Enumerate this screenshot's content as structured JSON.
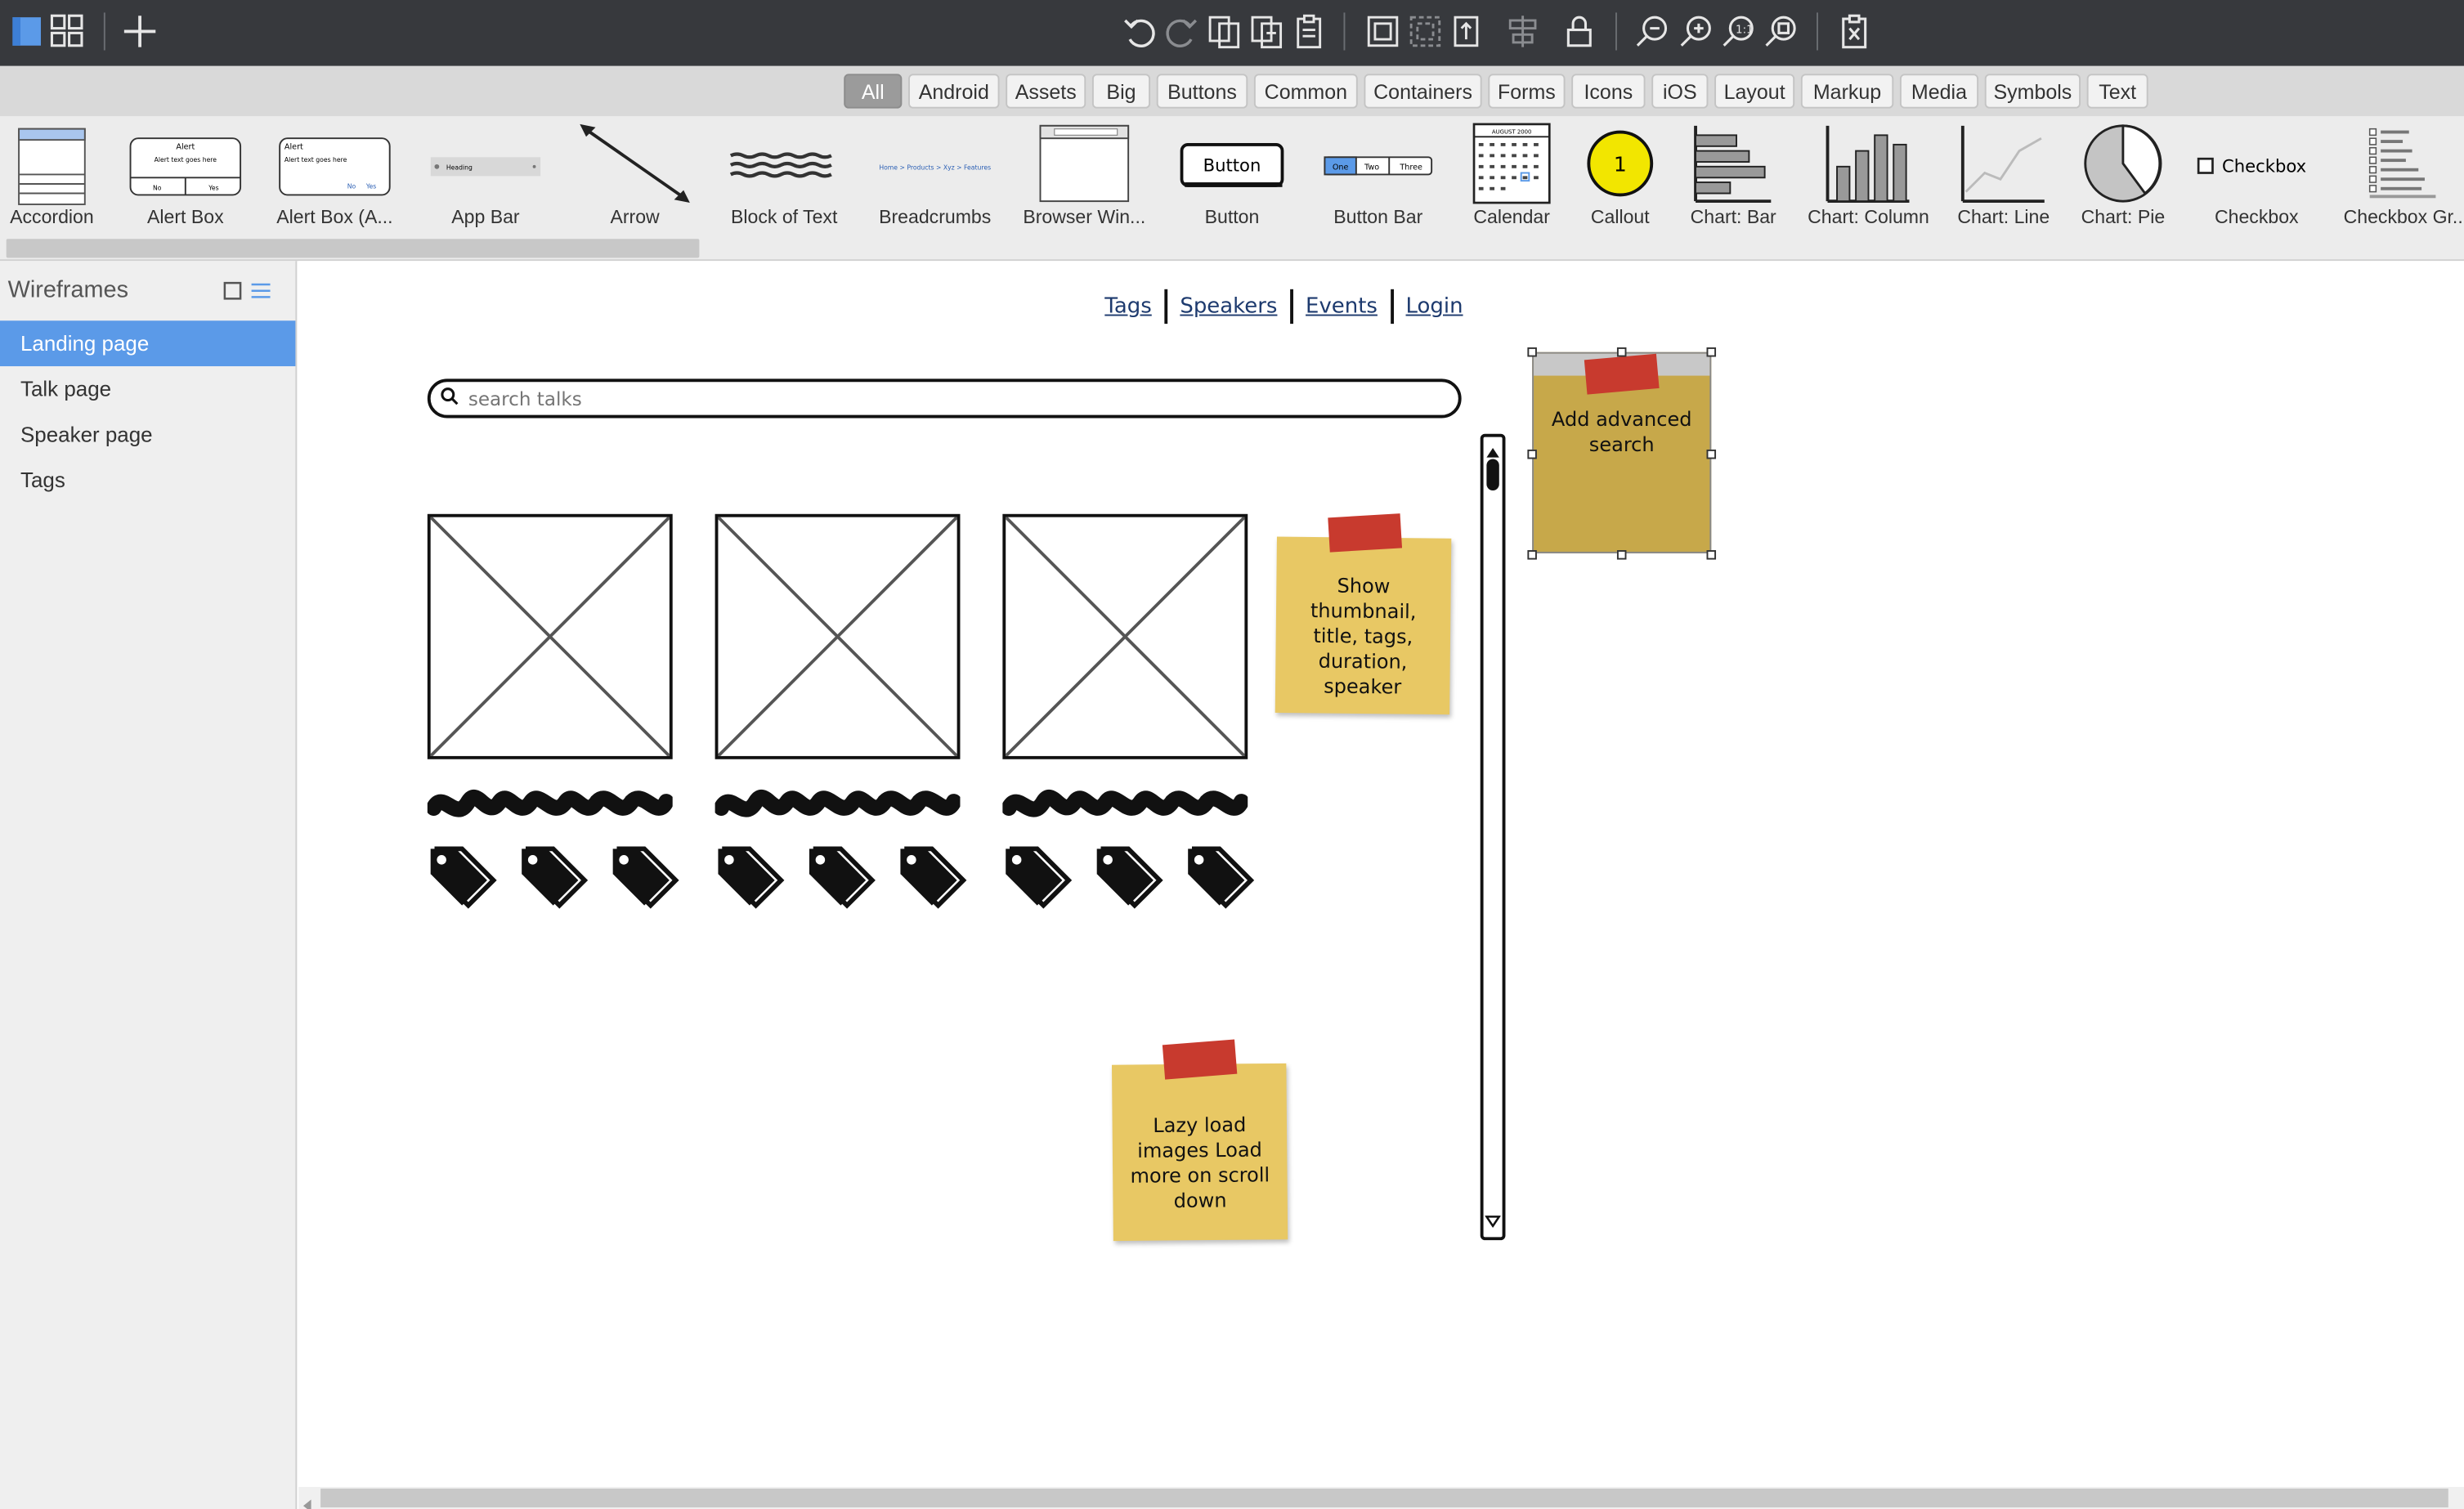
{
  "toolbar": {
    "icons": [
      "single-view-icon",
      "grid-view-icon",
      "add-icon",
      "undo-icon",
      "redo-icon",
      "copy-icon",
      "duplicate-icon",
      "paste-icon",
      "group-icon",
      "ungroup-icon",
      "bring-front-icon",
      "align-icon",
      "lock-icon",
      "zoom-out-icon",
      "zoom-in-icon",
      "actual-size-icon",
      "fit-icon",
      "delete-icon"
    ]
  },
  "filters": {
    "active": "All",
    "tabs": [
      "All",
      "Android",
      "Assets",
      "Big",
      "Buttons",
      "Common",
      "Containers",
      "Forms",
      "Icons",
      "iOS",
      "Layout",
      "Markup",
      "Media",
      "Symbols",
      "Text"
    ]
  },
  "library": {
    "items": [
      {
        "label": "Accordion"
      },
      {
        "label": "Alert Box"
      },
      {
        "label": "Alert Box (A..."
      },
      {
        "label": "App Bar"
      },
      {
        "label": "Arrow"
      },
      {
        "label": "Block of Text"
      },
      {
        "label": "Breadcrumbs"
      },
      {
        "label": "Browser Win..."
      },
      {
        "label": "Button"
      },
      {
        "label": "Button Bar"
      },
      {
        "label": "Calendar"
      },
      {
        "label": "Callout"
      },
      {
        "label": "Chart: Bar"
      },
      {
        "label": "Chart: Column"
      },
      {
        "label": "Chart: Line"
      },
      {
        "label": "Chart: Pie"
      },
      {
        "label": "Checkbox"
      },
      {
        "label": "Checkbox Gr..."
      }
    ],
    "thumb_text": {
      "alert_title": "Alert",
      "alert_body": "Alert text goes here",
      "alert_no": "No",
      "alert_yes": "Yes",
      "appbar_heading": "Heading",
      "button": "Button",
      "buttonbar": [
        "One",
        "Two",
        "Three"
      ],
      "callout": "1",
      "checkbox": "Checkbox",
      "calendar_month": "AUGUST 2000",
      "breadcrumbs": "Home > Products > Xyz > Features"
    }
  },
  "sidebar": {
    "title": "Wireframes",
    "items": [
      {
        "label": "Landing page",
        "active": true
      },
      {
        "label": "Talk page",
        "active": false
      },
      {
        "label": "Speaker page",
        "active": false
      },
      {
        "label": "Tags",
        "active": false
      }
    ]
  },
  "canvas": {
    "nav": [
      "Tags",
      "Speakers",
      "Events",
      "Login"
    ],
    "search": {
      "placeholder": "search talks"
    },
    "notes": {
      "thumbnail": "Show thumbnail, title, tags, duration, speaker",
      "lazy": "Lazy load images Load more on scroll down",
      "advanced": "Add advanced search"
    }
  },
  "colors": {
    "toolbar_bg": "#37393d",
    "accent": "#5b9ae8",
    "sticky": "#e8c864",
    "tape": "#c83a2e",
    "link": "#1d3a6e"
  }
}
